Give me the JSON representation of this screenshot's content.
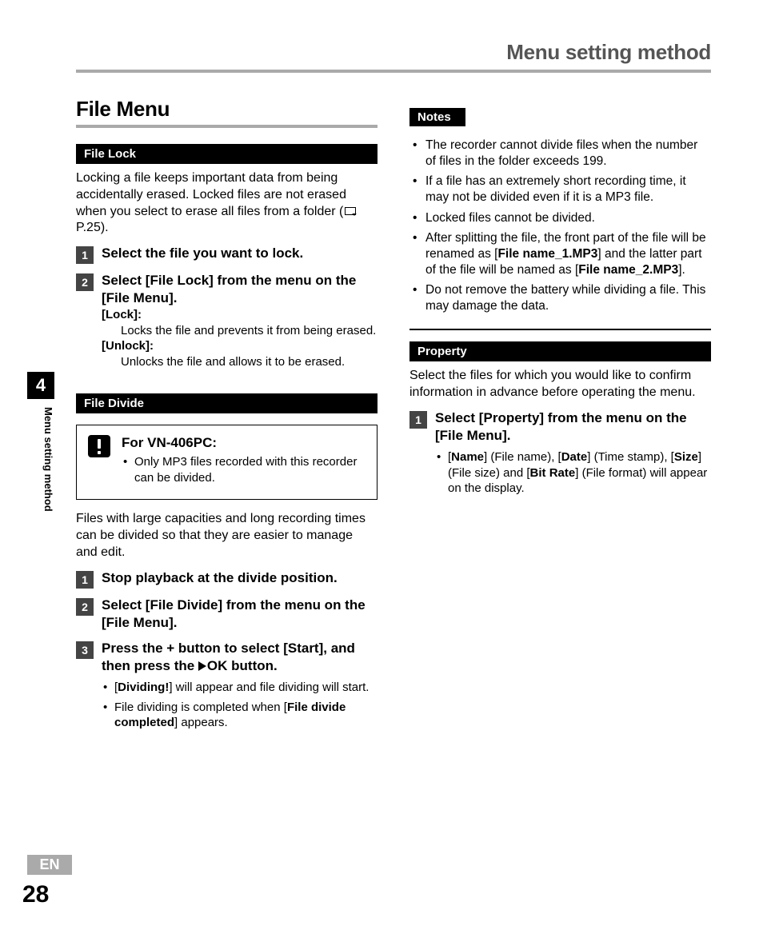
{
  "running_head": "Menu setting method",
  "section_title": "File Menu",
  "file_lock": {
    "heading": "File Lock",
    "intro_a": "Locking a file keeps important data from being accidentally erased. Locked files are not erased when you select to erase all files from a folder (",
    "intro_b": " P.25).",
    "step1": "Select the file you want to lock.",
    "step2_a": "Select [",
    "step2_b": "File Lock",
    "step2_c": "] from the menu on the [",
    "step2_d": "File Menu",
    "step2_e": "].",
    "lock_label": "[Lock]:",
    "lock_desc": "Locks the file and prevents it from being erased.",
    "unlock_label": "[Unlock]:",
    "unlock_desc": "Unlocks the file and allows it to be erased."
  },
  "file_divide": {
    "heading": "File Divide",
    "callout_title": "For VN-406PC:",
    "callout_item": "Only MP3 files recorded with this recorder can be divided.",
    "intro": "Files with large capacities and long recording times can be divided so that they are easier to manage and edit.",
    "step1": "Stop playback at the divide position.",
    "step2_a": "Select [",
    "step2_b": "File Divide",
    "step2_c": "] from the menu on the [",
    "step2_d": "File Menu",
    "step2_e": "].",
    "step3_a": "Press the + button to select [",
    "step3_b": "Start",
    "step3_c": "], and then press the ",
    "step3_d": "OK",
    "step3_e": " button.",
    "sub1_a": "[",
    "sub1_b": "Dividing!",
    "sub1_c": "] will appear and file dividing will start.",
    "sub2_a": "File dividing is completed when [",
    "sub2_b": "File divide completed",
    "sub2_c": "] appears."
  },
  "notes": {
    "heading": "Notes",
    "n1": "The recorder cannot divide files when the number of files in the folder exceeds 199.",
    "n2": "If a file has an extremely short recording time, it may not be divided even if it is a MP3 file.",
    "n3": "Locked files cannot be divided.",
    "n4_a": "After splitting the file, the front part of the file will be renamed as [",
    "n4_b": "File name_1.MP3",
    "n4_c": "] and the latter part of the file will be named as [",
    "n4_d": "File name_2.MP3",
    "n4_e": "].",
    "n5": "Do not remove the battery while dividing a file. This may damage the data."
  },
  "property": {
    "heading": "Property",
    "intro": "Select the files for which you would like to confirm information in advance before operating the menu.",
    "step1_a": "Select [",
    "step1_b": "Property",
    "step1_c": "] from the menu on the [",
    "step1_d": "File Menu",
    "step1_e": "].",
    "sub_a": "[",
    "sub_b": "Name",
    "sub_c": "] (File name), [",
    "sub_d": "Date",
    "sub_e": "] (Time stamp), [",
    "sub_f": "Size",
    "sub_g": "] (File size) and [",
    "sub_h": "Bit Rate",
    "sub_i": "] (File format) will appear on the display."
  },
  "side": {
    "chapter": "4",
    "label": "Menu setting method",
    "lang": "EN",
    "page": "28"
  }
}
